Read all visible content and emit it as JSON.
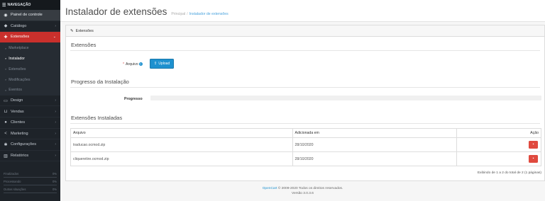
{
  "sidebar": {
    "header": "NAVEGAÇÃO",
    "items": [
      {
        "label": "Painel de controle",
        "icon": "dashboard-icon",
        "glyph": "◉"
      },
      {
        "label": "Catálogo",
        "icon": "tag-icon",
        "glyph": "◆"
      },
      {
        "label": "Extensões",
        "icon": "puzzle-icon",
        "glyph": "✚"
      }
    ],
    "subitems": [
      {
        "label": "Marketplace"
      },
      {
        "label": "Instalador"
      },
      {
        "label": "Extensões"
      },
      {
        "label": "Modificações"
      },
      {
        "label": "Eventos"
      }
    ],
    "items_after": [
      {
        "label": "Design",
        "icon": "monitor-icon",
        "glyph": "▭"
      },
      {
        "label": "Vendas",
        "icon": "cart-icon",
        "glyph": "⊔"
      },
      {
        "label": "Clientes",
        "icon": "user-icon",
        "glyph": "●"
      },
      {
        "label": "Marketing",
        "icon": "share-icon",
        "glyph": "<"
      },
      {
        "label": "Configurações",
        "icon": "gear-icon",
        "glyph": "✱"
      },
      {
        "label": "Relatórios",
        "icon": "bar-chart-icon",
        "glyph": "▥"
      }
    ],
    "stats": [
      {
        "label": "Finalizados",
        "value": "0%"
      },
      {
        "label": "Processando",
        "value": "0%"
      },
      {
        "label": "Outras situações",
        "value": "0%"
      }
    ]
  },
  "header": {
    "title": "Instalador de extensões",
    "breadcrumb_home": "Principal",
    "breadcrumb_sep": "/",
    "breadcrumb_current": "Instalador de extensões"
  },
  "panel": {
    "heading": "Extensões",
    "section_upload": "Extensões",
    "file_label": "Arquivo",
    "upload_button": "Upload",
    "section_progress": "Progresso da Instalação",
    "progress_label": "Progresso",
    "progress_value": 0,
    "section_installed": "Extensões Instaladas"
  },
  "table": {
    "headers": [
      "Arquivo",
      "Adicionada em",
      "Ação"
    ],
    "rows": [
      {
        "file": "traducao.ocmod.zip",
        "date": "28/10/2020"
      },
      {
        "file": "cliqueretire.ocmod.zip",
        "date": "28/10/2020"
      }
    ],
    "pagination": "Exibindo de 1 a 2 do total de 2 (1 páginas)"
  },
  "footer": {
    "link": "OpenCart",
    "copyright": "© 2009-2020 Todos os direitos reservados.",
    "version": "Versão 3.0.3.6"
  },
  "colors": {
    "sidebar_bg": "#1e2329",
    "active": "#c9302c",
    "primary": "#1e91cf",
    "danger": "#e04a3f"
  }
}
